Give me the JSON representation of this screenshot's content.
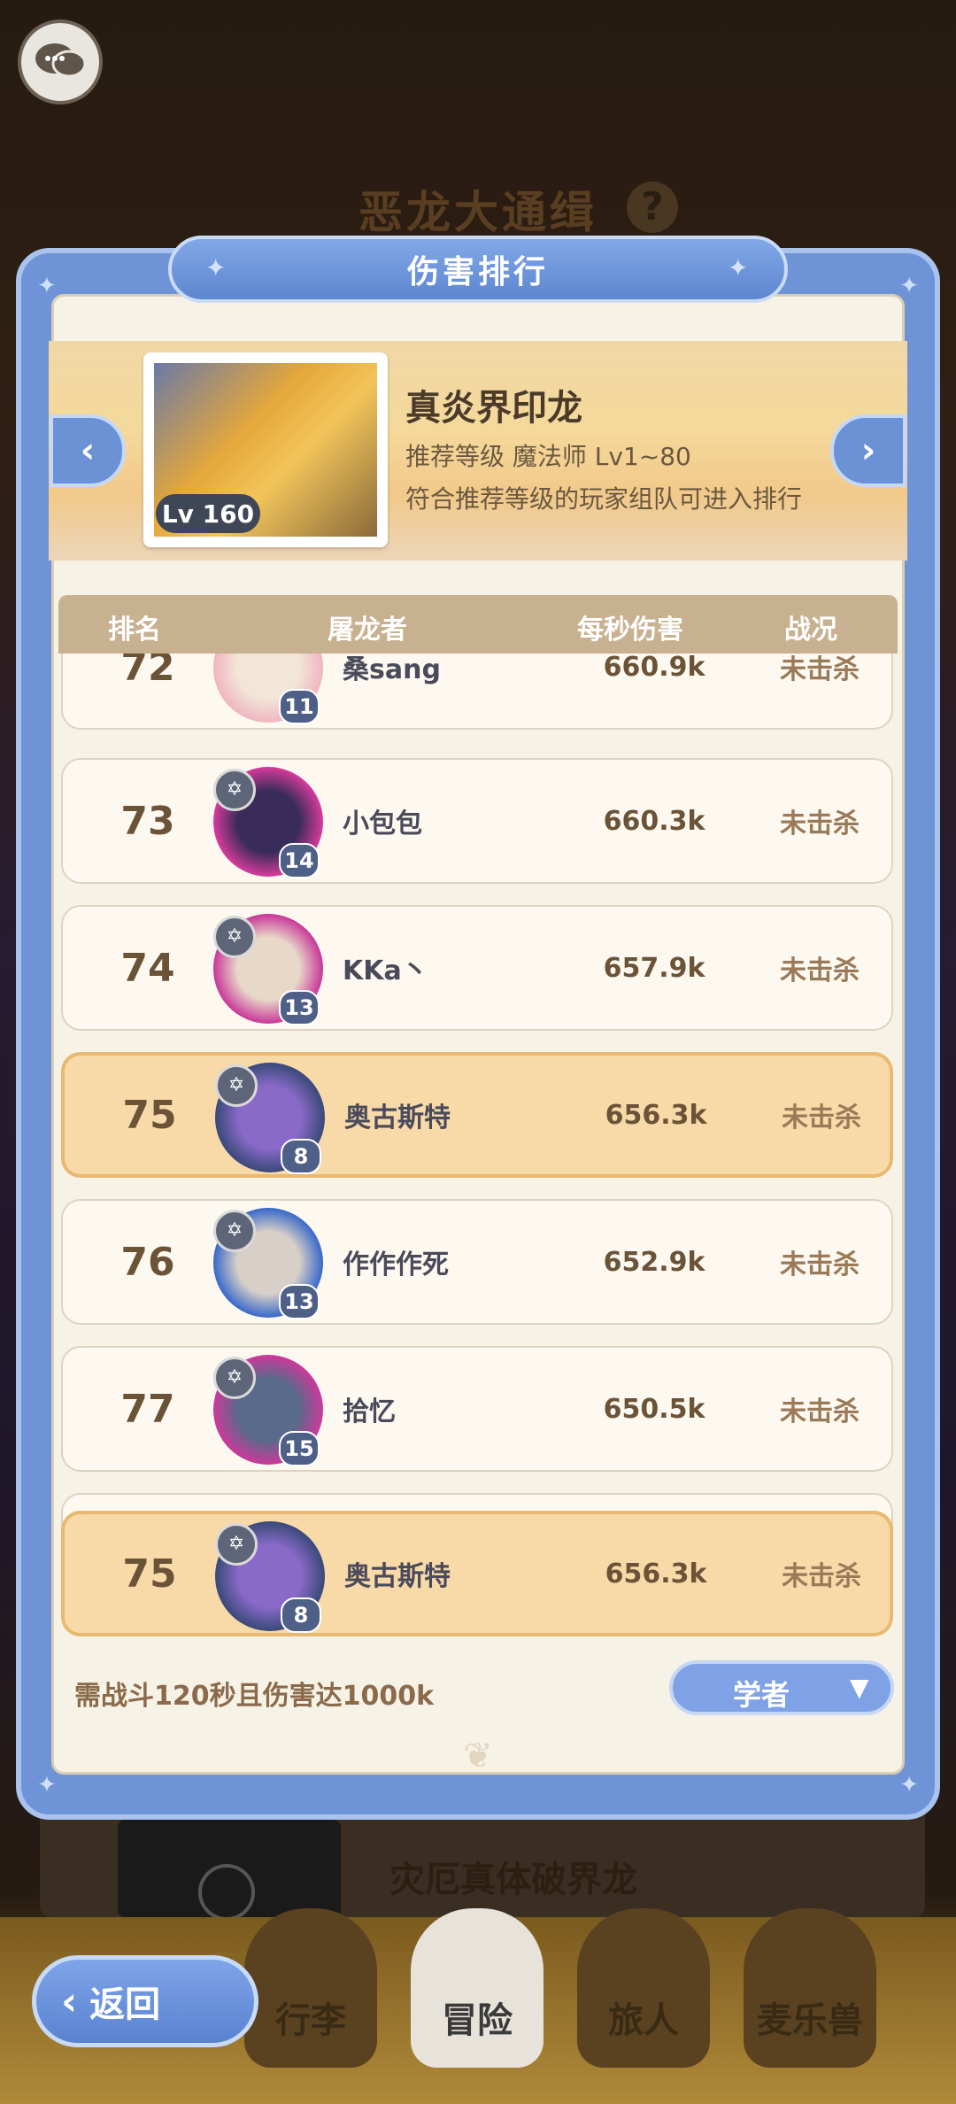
{
  "background": {
    "title": "恶龙大通缉",
    "help": "?",
    "behind_card_title": "灾厄真体破界龙"
  },
  "bottom_nav": [
    "行李",
    "冒险",
    "旅人",
    "麦乐兽"
  ],
  "back_button": "返回",
  "modal": {
    "title": "伤害排行",
    "boss": {
      "name": "真炎界印龙",
      "level_tag": "Lv 160",
      "recommend": "推荐等级 魔法师 Lv1~80",
      "note": "符合推荐等级的玩家组队可进入排行"
    },
    "columns": {
      "rank": "排名",
      "player": "屠龙者",
      "dps": "每秒伤害",
      "status": "战况"
    },
    "rows": [
      {
        "rank": "72",
        "name": "桑sang",
        "level": "11",
        "dps": "660.9k",
        "status": "未击杀"
      },
      {
        "rank": "73",
        "name": "小包包",
        "level": "14",
        "dps": "660.3k",
        "status": "未击杀"
      },
      {
        "rank": "74",
        "name": "KKa丶",
        "level": "13",
        "dps": "657.9k",
        "status": "未击杀"
      },
      {
        "rank": "75",
        "name": "奥古斯特",
        "level": "8",
        "dps": "656.3k",
        "status": "未击杀"
      },
      {
        "rank": "76",
        "name": "作作作死",
        "level": "13",
        "dps": "652.9k",
        "status": "未击杀"
      },
      {
        "rank": "77",
        "name": "拾忆",
        "level": "15",
        "dps": "650.5k",
        "status": "未击杀"
      }
    ],
    "self_row": {
      "rank": "75",
      "name": "奥古斯特",
      "level": "8",
      "dps": "656.3k",
      "status": "未击杀"
    },
    "requirement": "需战斗120秒且伤害达1000k",
    "class_filter": "学者"
  },
  "colors": {
    "modal_blue": "#6e93d6",
    "highlight": "#f8d9a8",
    "table_head": "#c8b190"
  }
}
